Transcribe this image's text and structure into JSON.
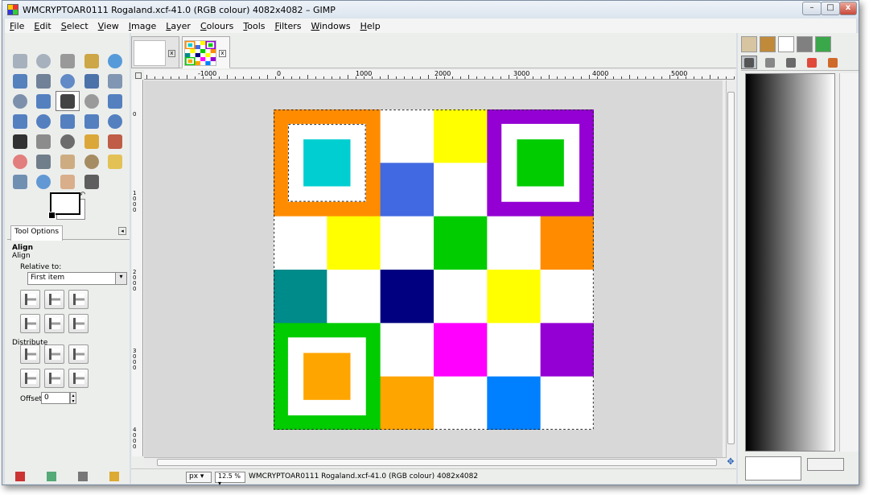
{
  "window": {
    "title": "WMCRYPTOAR0111 Rogaland.xcf-41.0 (RGB colour) 4082x4082 – GIMP",
    "minimize_label": "–",
    "maximize_label": "□",
    "close_label": "x"
  },
  "menubar": {
    "items": [
      "File",
      "Edit",
      "Select",
      "View",
      "Image",
      "Layer",
      "Colours",
      "Tools",
      "Filters",
      "Windows",
      "Help"
    ]
  },
  "toolbox": {
    "tools": [
      {
        "name": "rect-select",
        "icon": "rect-select-icon",
        "color": "#9aa6b5"
      },
      {
        "name": "ellipse-select",
        "icon": "ellipse-select-icon",
        "color": "#9aa6b5"
      },
      {
        "name": "free-select",
        "icon": "lasso-icon",
        "color": "#8a8a8a"
      },
      {
        "name": "fuzzy-select",
        "icon": "magic-wand-icon",
        "color": "#c89a2a"
      },
      {
        "name": "color-select",
        "icon": "color-select-icon",
        "color": "#3d8bd6"
      },
      {
        "name": "scissors",
        "icon": "scissors-icon",
        "color": "#3b6db5"
      },
      {
        "name": "foreground-select",
        "icon": "foreground-select-icon",
        "color": "#5b6d8a"
      },
      {
        "name": "paths",
        "icon": "paths-icon",
        "color": "#4a78c0"
      },
      {
        "name": "color-picker",
        "icon": "eyedropper-icon",
        "color": "#2f5c9e"
      },
      {
        "name": "zoom",
        "icon": "magnifier-icon",
        "color": "#6f86a8"
      },
      {
        "name": "measure",
        "icon": "compass-icon",
        "color": "#6a7fa0"
      },
      {
        "name": "move",
        "icon": "move-icon",
        "color": "#3a6cb8"
      },
      {
        "name": "align",
        "icon": "align-icon",
        "color": "#222222",
        "selected": true
      },
      {
        "name": "crop",
        "icon": "crop-icon",
        "color": "#8b8b8b"
      },
      {
        "name": "rotate",
        "icon": "rotate-icon",
        "color": "#3a6cb8"
      },
      {
        "name": "scale",
        "icon": "scale-icon",
        "color": "#3a6cb8"
      },
      {
        "name": "shear",
        "icon": "shear-icon",
        "color": "#3a6cb8"
      },
      {
        "name": "perspective",
        "icon": "perspective-icon",
        "color": "#3a6cb8"
      },
      {
        "name": "flip",
        "icon": "flip-icon",
        "color": "#3a6cb8"
      },
      {
        "name": "cage",
        "icon": "cage-icon",
        "color": "#3a6cb8"
      },
      {
        "name": "text",
        "icon": "text-icon",
        "color": "#111111"
      },
      {
        "name": "bucket-fill",
        "icon": "bucket-icon",
        "color": "#7a7a7a"
      },
      {
        "name": "blend",
        "icon": "gradient-icon",
        "color": "#555555"
      },
      {
        "name": "pencil",
        "icon": "pencil-icon",
        "color": "#d99a1a"
      },
      {
        "name": "paintbrush",
        "icon": "paintbrush-icon",
        "color": "#b7432a"
      },
      {
        "name": "eraser",
        "icon": "eraser-icon",
        "color": "#e06a6a"
      },
      {
        "name": "airbrush",
        "icon": "airbrush-icon",
        "color": "#5a6a7a"
      },
      {
        "name": "ink",
        "icon": "ink-icon",
        "color": "#c8a070"
      },
      {
        "name": "clone",
        "icon": "clone-stamp-icon",
        "color": "#9a7a4a"
      },
      {
        "name": "heal",
        "icon": "heal-icon",
        "color": "#e2b93a"
      },
      {
        "name": "perspective-clone",
        "icon": "perspective-clone-icon",
        "color": "#5a7fa8"
      },
      {
        "name": "blur",
        "icon": "blur-icon",
        "color": "#4a8ad0"
      },
      {
        "name": "smudge",
        "icon": "smudge-icon",
        "color": "#d6a27a"
      },
      {
        "name": "dodge-burn",
        "icon": "dodge-burn-icon",
        "color": "#444444"
      }
    ],
    "swap_label": "↶"
  },
  "tool_options": {
    "tab_label": "Tool Options",
    "tab_menu": "◂",
    "heading": "Align",
    "subheading": "Align",
    "relative_label": "Relative to:",
    "relative_value": "First item",
    "distribute_label": "Distribute",
    "offset_label": "Offset:",
    "offset_value": "0",
    "align_buttons": [
      "align-left-icon",
      "align-center-icon",
      "align-right-icon",
      "align-top-icon",
      "align-middle-icon",
      "align-bottom-icon"
    ],
    "distribute_buttons": [
      "distribute-left-icon",
      "distribute-center-icon",
      "distribute-right-icon",
      "distribute-top-icon",
      "distribute-middle-icon",
      "distribute-bottom-icon"
    ]
  },
  "image_window": {
    "tab_close": "x",
    "hruler_labels": [
      "-1000",
      "0",
      "1000",
      "2000",
      "3000",
      "4000",
      "5000"
    ],
    "vruler_labels": [
      "0",
      "1000",
      "2000",
      "3000",
      "4000"
    ],
    "unit": "px",
    "zoom": "12.5 %",
    "status": "WMCRYPTOAR0111 Rogaland.xcf-41.0 (RGB colour) 4082x4082",
    "image_grid": [
      [
        "#ff8c00",
        "#ff8c00",
        "#ffffff",
        "#ffff00",
        "#9400d3",
        "#9400d3"
      ],
      [
        "#ff8c00",
        "#ff8c00",
        "#4169e1",
        "#ffffff",
        "#9400d3",
        "#9400d3"
      ],
      [
        "#ffffff",
        "#ffff00",
        "#ffffff",
        "#00cc00",
        "#ffffff",
        "#ff8c00"
      ],
      [
        "#008b8b",
        "#ffffff",
        "#000080",
        "#ffffff",
        "#ffff00",
        "#ffffff"
      ],
      [
        "#00cc00",
        "#00cc00",
        "#ffffff",
        "#ff00ff",
        "#ffffff",
        "#9400d3"
      ],
      [
        "#00cc00",
        "#00cc00",
        "#ffa500",
        "#ffffff",
        "#0080ff",
        "#ffffff"
      ]
    ],
    "big_squares": [
      {
        "row": 0,
        "col": 0,
        "outer": "#ff8c00",
        "inner": "#00ced1"
      },
      {
        "row": 0,
        "col": 4,
        "outer": "#9400d3",
        "inner": "#00cc00"
      },
      {
        "row": 4,
        "col": 0,
        "outer": "#00cc00",
        "inner": "#ffa500"
      }
    ],
    "nav_icon": "✥"
  },
  "dock": {
    "tabs": [
      {
        "icon": "pattern-tab-icon",
        "color": "#d6c5a0"
      },
      {
        "icon": "brushes-tab-icon",
        "color": "#c08a3a"
      },
      {
        "icon": "fonts-tab-icon",
        "color": "#ffffff"
      },
      {
        "icon": "gradients-tab-icon",
        "color": "#808080"
      },
      {
        "icon": "palettes-tab-icon",
        "color": "#3aa84a"
      }
    ],
    "subtabs": [
      {
        "icon": "layers-icon",
        "color": "#555555"
      },
      {
        "icon": "channels-icon",
        "color": "#888888"
      },
      {
        "icon": "paths-dock-icon",
        "color": "#6a6a6a"
      },
      {
        "icon": "colormap-icon",
        "color": "#e04a3a"
      },
      {
        "icon": "histogram-icon",
        "color": "#d06a2a"
      }
    ]
  }
}
